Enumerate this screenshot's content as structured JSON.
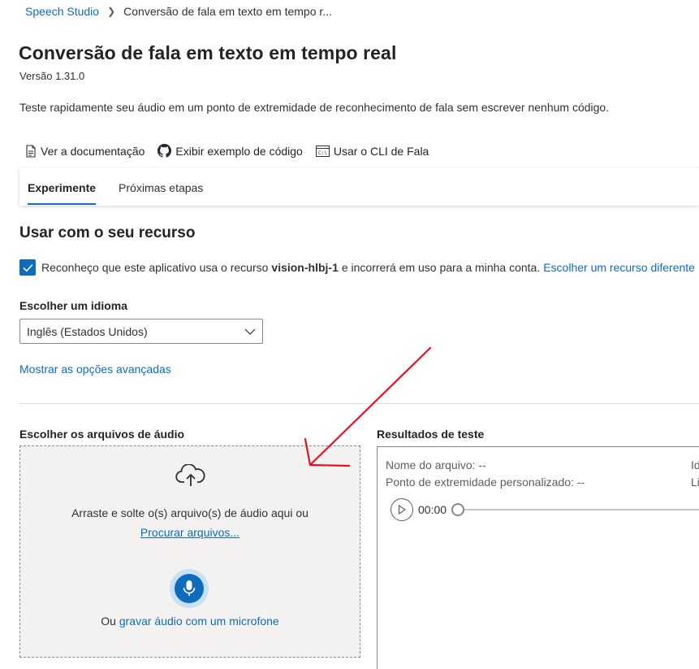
{
  "breadcrumb": {
    "root": "Speech Studio",
    "current": "Conversão de fala em texto em tempo r..."
  },
  "header": {
    "title": "Conversão de fala em texto em tempo real",
    "version": "Versão 1.31.0",
    "description": "Teste rapidamente seu áudio em um ponto de extremidade de reconhecimento de fala sem escrever nenhum código."
  },
  "links": {
    "docs": "Ver a documentação",
    "sample": "Exibir exemplo de código",
    "cli": "Usar o CLI de Fala"
  },
  "tabs": [
    {
      "label": "Experimente",
      "active": true
    },
    {
      "label": "Próximas etapas",
      "active": false
    }
  ],
  "resource_section": {
    "title": "Usar com o seu recurso",
    "consent_prefix": "Reconheço que este aplicativo usa o recurso",
    "resource_name": "vision-hlbj-1",
    "consent_suffix": "e incorrerá em uso para a minha conta.",
    "change_link": "Escolher um recurso diferente",
    "checked": true
  },
  "language": {
    "label": "Escolher um idioma",
    "selected": "Inglês (Estados Unidos)"
  },
  "advanced_link": "Mostrar as opções avançadas",
  "audio_files": {
    "label": "Escolher os arquivos de áudio",
    "drop_text": "Arraste e solte o(s) arquivo(s) de áudio aqui ou",
    "browse_link": "Procurar arquivos...",
    "record_prefix": "Ou",
    "record_link": "gravar áudio com um microfone"
  },
  "results": {
    "label": "Resultados de teste",
    "file_name": "Nome do arquivo: --",
    "endpoint": "Ponto de extremidade personalizado: --",
    "cut_right_1": "Id",
    "cut_right_2": "Li",
    "time": "00:00"
  },
  "colors": {
    "accent": "#0f6cbd",
    "annotation": "#e81123"
  },
  "icons": [
    "document-icon",
    "github-icon",
    "terminal-icon",
    "checkmark-icon",
    "chevron-down-icon",
    "cloud-upload-icon",
    "microphone-icon",
    "play-icon"
  ]
}
